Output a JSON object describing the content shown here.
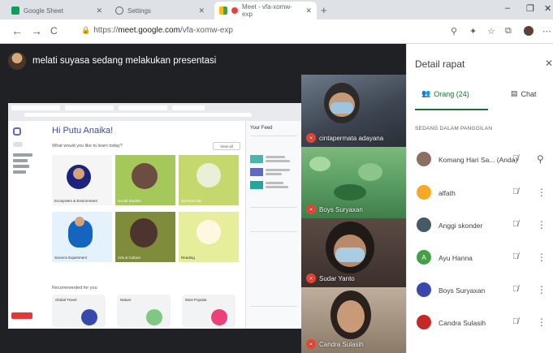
{
  "browser": {
    "tabs": [
      {
        "label": "Google Sheet",
        "icon": "sheets-icon",
        "active": false
      },
      {
        "label": "Settings",
        "icon": "gear-icon",
        "active": false
      },
      {
        "label": "Meet - vfa-xomw-exp",
        "icon": "meet-icon",
        "active": true
      }
    ],
    "new_tab": "+",
    "window_controls": {
      "minimize": "–",
      "restore": "❐",
      "close": "✕"
    },
    "nav": {
      "back": "←",
      "forward": "→",
      "reload": "C"
    },
    "url_prefix": "https://",
    "url_host": "meet.google.com",
    "url_path": "/vfa-xomw-exp"
  },
  "stage": {
    "presenter_banner": "melati suyasa sedang melakukan presentasi",
    "shared_screen": {
      "greeting": "Hi Putu Anaika!",
      "question": "What would you like to learn today?",
      "button": "View all",
      "cards": [
        {
          "caption": "Ecosystem & Environment"
        },
        {
          "caption": "Social Studies"
        },
        {
          "caption": "Science Lab"
        },
        {
          "caption": "Science Experiment"
        },
        {
          "caption": "Arts & Culture"
        },
        {
          "caption": "Reading"
        }
      ],
      "recent_label": "Recommended for you",
      "recent": [
        {
          "label": "Global Travel"
        },
        {
          "label": "Nature"
        },
        {
          "label": "Most Popular"
        }
      ],
      "sidebar_header": "Your Feed"
    },
    "participants": [
      {
        "name": "cintapermata adayana"
      },
      {
        "name": "Boys Suryaxan"
      },
      {
        "name": "Sudar Yanto"
      },
      {
        "name": "Candra Sulasih"
      }
    ]
  },
  "panel": {
    "title": "Detail rapat",
    "close": "✕",
    "tabs": {
      "people": "Orang (24)",
      "chat": "Chat"
    },
    "section_label": "SEDANG DALAM PANGGILAN",
    "people": [
      {
        "name": "Komang Hari Sa... (Anda)",
        "color": "#8d6e63"
      },
      {
        "name": "alfath",
        "color": "#f9a825"
      },
      {
        "name": "Anggi skonder",
        "color": "#455a64"
      },
      {
        "name": "Ayu Hanna",
        "color": "#43a047"
      },
      {
        "name": "Boys Suryaxan",
        "color": "#3949ab"
      },
      {
        "name": "Candra Sulasih",
        "color": "#c62828"
      }
    ]
  }
}
